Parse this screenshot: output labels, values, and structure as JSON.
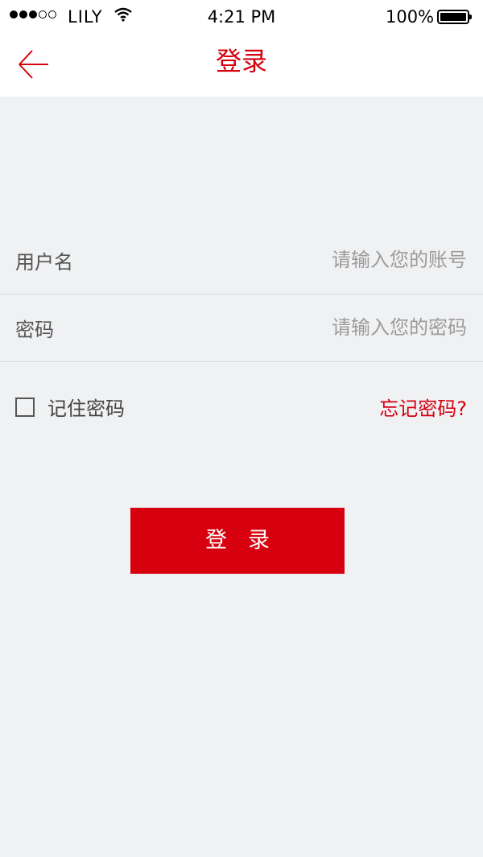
{
  "status_bar": {
    "carrier": "LILY",
    "time": "4:21 PM",
    "battery": "100%",
    "signal_bars_filled": 3,
    "signal_bars_total": 5
  },
  "nav": {
    "back_icon": "back-arrow-icon",
    "title": "登录"
  },
  "form": {
    "username": {
      "label": "用户名",
      "placeholder": "请输入您的账号",
      "value": ""
    },
    "password": {
      "label": "密码",
      "placeholder": "请输入您的密码",
      "value": ""
    }
  },
  "options": {
    "remember_label": "记住密码",
    "remember_checked": false,
    "forgot_label": "忘记密码?"
  },
  "login_button_label": "登录",
  "colors": {
    "accent": "#d6000f",
    "background": "#f0f1f3"
  }
}
